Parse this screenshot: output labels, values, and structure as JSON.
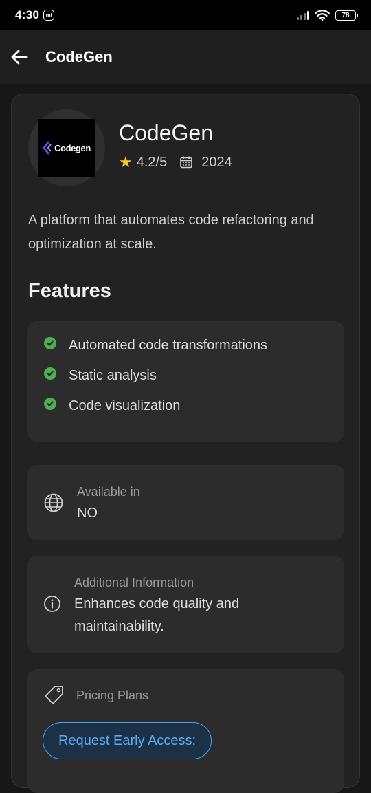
{
  "status": {
    "time": "4:30",
    "mi_badge": "mi",
    "battery": "78"
  },
  "appbar": {
    "title": "CodeGen"
  },
  "tool": {
    "logo_text": "Codegen",
    "name": "CodeGen",
    "rating": "4.2/5",
    "year": "2024",
    "description": "A platform that automates code refactoring and optimization at scale."
  },
  "features": {
    "title": "Features",
    "items": [
      "Automated code transformations",
      "Static analysis",
      "Code visualization"
    ]
  },
  "availability": {
    "label": "Available in",
    "value": "NO"
  },
  "additional": {
    "label": "Additional Information",
    "value": "Enhances code quality and maintainability."
  },
  "pricing": {
    "label": "Pricing Plans",
    "button": "Request Early Access:"
  },
  "colors": {
    "accent": "#4aa3f0",
    "check": "#4caf50",
    "star": "#f6c431",
    "background": "#171717",
    "card": "#222222"
  },
  "icons": [
    "back-arrow-icon",
    "star-icon",
    "calendar-icon",
    "check-circle-icon",
    "globe-icon",
    "info-icon",
    "tag-icon",
    "wifi-icon",
    "signal-icon",
    "battery-icon"
  ]
}
